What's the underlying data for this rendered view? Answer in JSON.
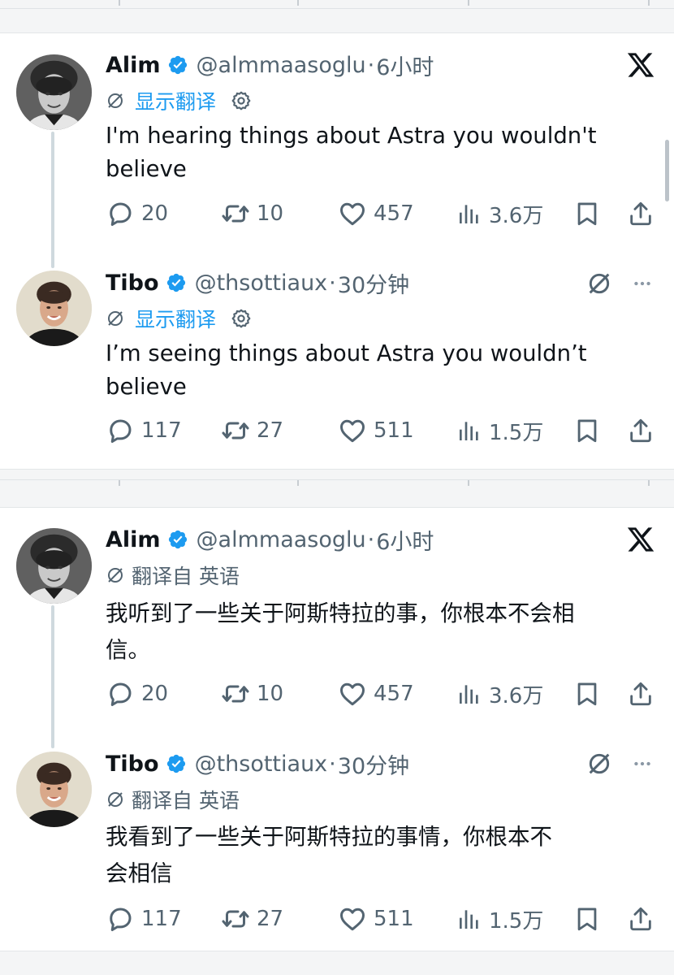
{
  "posts": [
    {
      "author": "Alim",
      "handle": "@almmaasoglu",
      "time": "6小时",
      "translate_link": "显示翻译",
      "translate_note": "",
      "text": "I'm hearing things about Astra you wouldn't\nbelieve",
      "replies": "20",
      "reposts": "10",
      "likes": "457",
      "views": "3.6万"
    },
    {
      "author": "Tibo",
      "handle": "@thsottiaux",
      "time": "30分钟",
      "translate_link": "显示翻译",
      "translate_note": "",
      "text": "I’m seeing things about Astra you wouldn’t\nbelieve",
      "replies": "117",
      "reposts": "27",
      "likes": "511",
      "views": "1.5万"
    },
    {
      "author": "Alim",
      "handle": "@almmaasoglu",
      "time": "6小时",
      "translate_link": "",
      "translate_note": "翻译自 英语",
      "text": "我听到了一些关于阿斯特拉的事，你根本不会相\n信。",
      "replies": "20",
      "reposts": "10",
      "likes": "457",
      "views": "3.6万"
    },
    {
      "author": "Tibo",
      "handle": "@thsottiaux",
      "time": "30分钟",
      "translate_link": "",
      "translate_note": "翻译自 英语",
      "text": "我看到了一些关于阿斯特拉的事情，你根本不\n会相信",
      "replies": "117",
      "reposts": "27",
      "likes": "511",
      "views": "1.5万"
    }
  ],
  "separator_dot": "·",
  "colors": {
    "accent": "#1d9bf0",
    "text": "#0f1419",
    "secondary": "#536471",
    "thread_line": "#cfd9de"
  },
  "icons": [
    "x-logo-icon",
    "verified-badge-icon",
    "translate-icon",
    "gear-icon",
    "reply-icon",
    "repost-icon",
    "like-icon",
    "views-icon",
    "bookmark-icon",
    "share-icon",
    "muted-icon",
    "more-icon"
  ]
}
